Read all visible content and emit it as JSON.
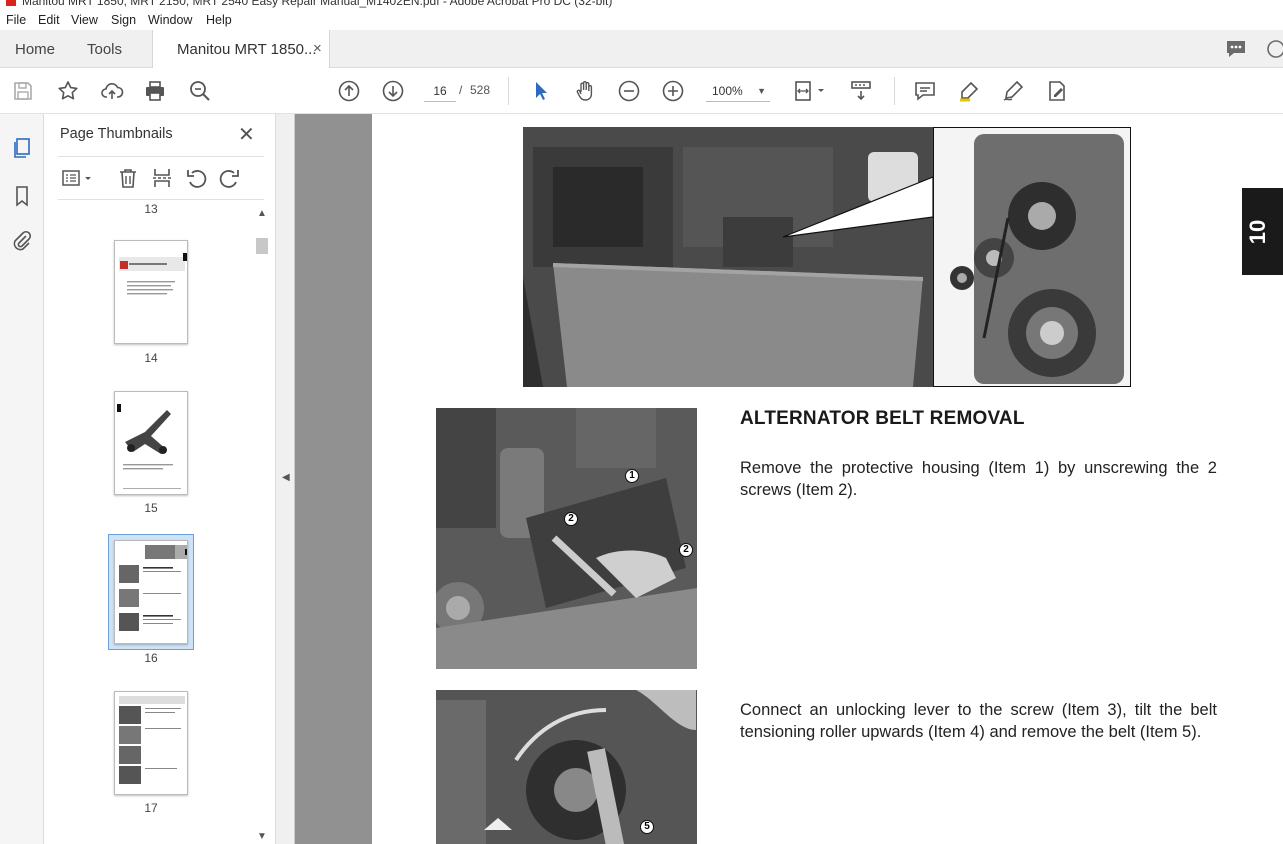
{
  "window": {
    "title": "Manitou MRT 1850, MRT 2150, MRT 2540 Easy Repair Manual_M1402EN.pdf - Adobe Acrobat Pro DC (32-bit)"
  },
  "menu": [
    "File",
    "Edit",
    "View",
    "Sign",
    "Window",
    "Help"
  ],
  "tabs": {
    "home": "Home",
    "tools": "Tools",
    "document": "Manitou MRT 1850...",
    "close": "×"
  },
  "toolbar": {
    "current_page": "16",
    "separator": "/",
    "total_pages": "528",
    "zoom": "100%"
  },
  "panel": {
    "title": "Page Thumbnails",
    "close": "✕",
    "thumbnails": [
      {
        "label": "13"
      },
      {
        "label": "14"
      },
      {
        "label": "15"
      },
      {
        "label": "16",
        "selected": true
      },
      {
        "label": "17"
      }
    ]
  },
  "document": {
    "chapter_tab": "10",
    "heading": "ALTERNATOR BELT REMOVAL",
    "paragraph1": "Remove the protective housing (Item 1) by unscrewing the 2 screws (Item 2).",
    "paragraph2": "Connect an unlocking lever to the screw (Item 3), tilt the belt tensioning roller upwards (Item 4) and remove the belt (Item 5).",
    "callouts": [
      "1",
      "2",
      "2",
      "5"
    ]
  },
  "colors": {
    "accent_blue": "#2d6bbf",
    "viewer_gray": "#919191",
    "chapter_tab": "#1a1a1a"
  }
}
